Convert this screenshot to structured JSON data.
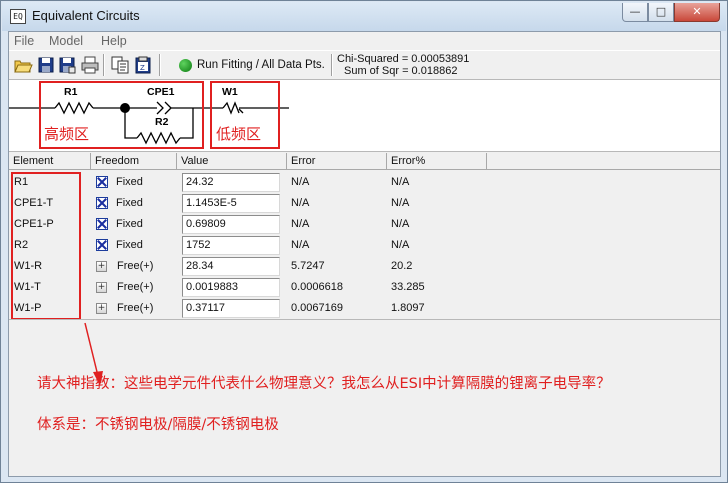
{
  "window": {
    "title": "Equivalent Circuits",
    "icon": "app-icon",
    "icon_text": "EQ"
  },
  "menu": [
    "File",
    "Model",
    "Help"
  ],
  "toolbar": {
    "icons": [
      "open-folder-icon",
      "save-icon",
      "save-as-icon",
      "print-icon",
      "copy-icon",
      "clipboard-icon"
    ],
    "run_label": "Run Fitting / All Data Pts.",
    "chi_squared": "Chi-Squared = 0.00053891",
    "sum_of_sqr": "Sum of Sqr = 0.018862"
  },
  "circuit": {
    "r1": "R1",
    "cpe1": "CPE1",
    "r2": "R2",
    "w1": "W1",
    "high_freq_label": "高频区",
    "low_freq_label": "低频区"
  },
  "table": {
    "columns": [
      "Element",
      "Freedom",
      "Value",
      "Error",
      "Error%"
    ],
    "rows": [
      {
        "element": "R1",
        "freedom": "Fixed",
        "freedom_icon": "fixed-x-icon",
        "value": "24.32",
        "error": "N/A",
        "error_pct": "N/A"
      },
      {
        "element": "CPE1-T",
        "freedom": "Fixed",
        "freedom_icon": "fixed-x-icon",
        "value": "1.1453E-5",
        "error": "N/A",
        "error_pct": "N/A"
      },
      {
        "element": "CPE1-P",
        "freedom": "Fixed",
        "freedom_icon": "fixed-x-icon",
        "value": "0.69809",
        "error": "N/A",
        "error_pct": "N/A"
      },
      {
        "element": "R2",
        "freedom": "Fixed",
        "freedom_icon": "fixed-x-icon",
        "value": "1752",
        "error": "N/A",
        "error_pct": "N/A"
      },
      {
        "element": "W1-R",
        "freedom": "Free(+)",
        "freedom_icon": "free-plus-icon",
        "value": "28.34",
        "error": "5.7247",
        "error_pct": "20.2"
      },
      {
        "element": "W1-T",
        "freedom": "Free(+)",
        "freedom_icon": "free-plus-icon",
        "value": "0.0019883",
        "error": "0.0006618",
        "error_pct": "33.285"
      },
      {
        "element": "W1-P",
        "freedom": "Free(+)",
        "freedom_icon": "free-plus-icon",
        "value": "0.37117",
        "error": "0.0067169",
        "error_pct": "1.8097"
      }
    ]
  },
  "annotation": {
    "question": "请大神指教：这些电学元件代表什么物理意义？我怎么从ESI中计算隔膜的锂离子电导率？",
    "system": "体系是：不锈钢电极/隔膜/不锈钢电极"
  },
  "colors": {
    "annotation_red": "#e02020",
    "run_green": "#0b7a10",
    "fixed_blue": "#1a2ea0"
  }
}
